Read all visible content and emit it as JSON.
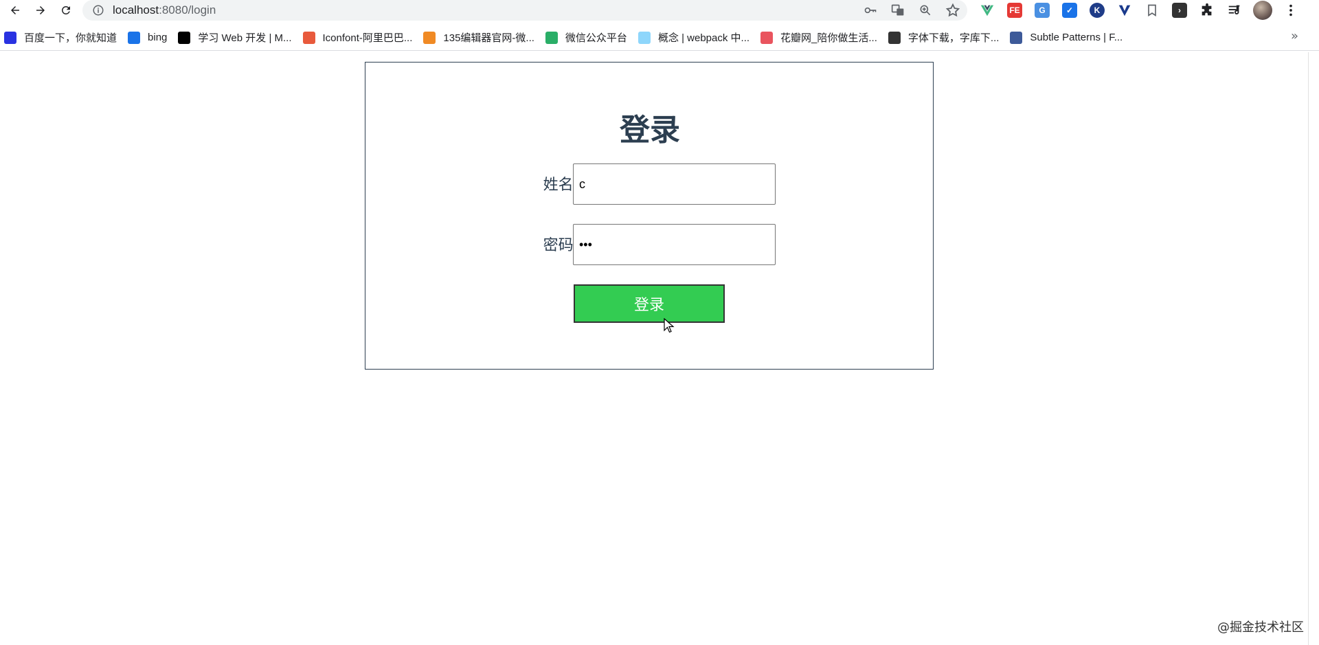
{
  "browser": {
    "url_host": "localhost",
    "url_rest": ":8080/login",
    "bookmarks": [
      {
        "label": "百度一下，你就知道",
        "icon": "baidu-icon",
        "color": "#2932e1"
      },
      {
        "label": "bing",
        "icon": "bing-icon",
        "color": "#1a73e8"
      },
      {
        "label": "学习 Web 开发 | M...",
        "icon": "mdn-icon",
        "color": "#000000"
      },
      {
        "label": "Iconfont-阿里巴巴...",
        "icon": "iconfont-icon",
        "color": "#e85a3c"
      },
      {
        "label": "135编辑器官网-微...",
        "icon": "editor135-icon",
        "color": "#f08a24"
      },
      {
        "label": "微信公众平台",
        "icon": "wechat-icon",
        "color": "#2aae67"
      },
      {
        "label": "概念 | webpack 中...",
        "icon": "webpack-icon",
        "color": "#8ed6fb"
      },
      {
        "label": "花瓣网_陪你做生活...",
        "icon": "huaban-icon",
        "color": "#e9545e"
      },
      {
        "label": "字体下载，字库下...",
        "icon": "globe-icon",
        "color": "#333333"
      },
      {
        "label": "Subtle Patterns | F...",
        "icon": "subtle-patterns-icon",
        "color": "#3d5a99"
      }
    ],
    "more_bookmarks": "»"
  },
  "page": {
    "title": "登录",
    "name_label": "姓名:",
    "name_value": "c",
    "password_label": "密码:",
    "password_value": "abc",
    "submit_label": "登录",
    "watermark": "@掘金技术社区"
  },
  "colors": {
    "primary_text": "#2c3e50",
    "button_green": "#33cc52"
  }
}
